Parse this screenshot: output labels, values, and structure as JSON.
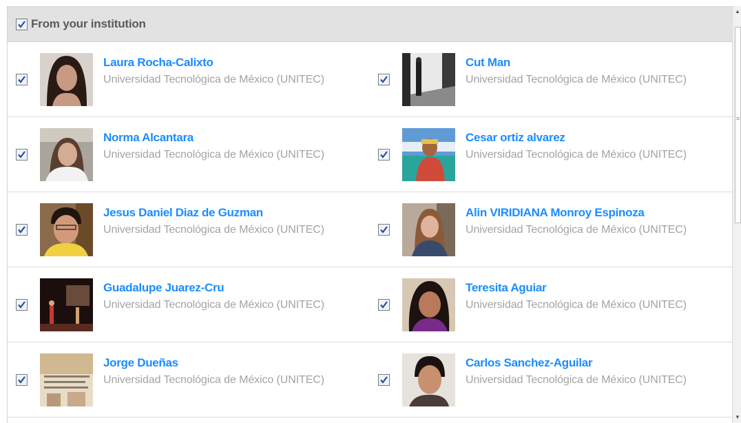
{
  "section": {
    "title": "From your institution",
    "checked": true
  },
  "people": [
    {
      "name": "Laura Rocha-Calixto",
      "institution": "Universidad Tecnológica de México (UNITEC)"
    },
    {
      "name": "Cut Man",
      "institution": "Universidad Tecnológica de México (UNITEC)"
    },
    {
      "name": "Norma Alcantara",
      "institution": "Universidad Tecnológica de México (UNITEC)"
    },
    {
      "name": "Cesar ortiz alvarez",
      "institution": "Universidad Tecnológica de México (UNITEC)"
    },
    {
      "name": "Jesus Daniel Diaz de Guzman",
      "institution": "Universidad Tecnológica de México (UNITEC)"
    },
    {
      "name": "Alin VIRIDIANA Monroy Espinoza",
      "institution": "Universidad Tecnológica de México (UNITEC)"
    },
    {
      "name": "Guadalupe Juarez-Cru",
      "institution": "Universidad Tecnológica de México (UNITEC)"
    },
    {
      "name": "Teresita Aguiar",
      "institution": "Universidad Tecnológica de México (UNITEC)"
    },
    {
      "name": "Jorge Dueñas",
      "institution": "Universidad Tecnológica de México (UNITEC)"
    },
    {
      "name": "Carlos Sanchez-Aguilar",
      "institution": "Universidad Tecnológica de México (UNITEC)"
    }
  ],
  "colors": {
    "name_link": "#1a8cff",
    "institution_text": "#a3a3a3",
    "header_bg": "#e2e2e2"
  },
  "icons": {
    "checkbox": "checkbox-checked-icon",
    "avatar": "profile-photo"
  }
}
